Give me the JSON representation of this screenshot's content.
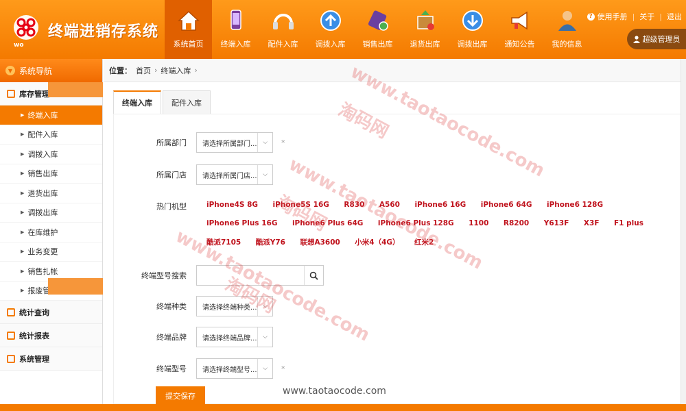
{
  "app": {
    "title": "终端进销存系统"
  },
  "nav": [
    {
      "label": "系统首页",
      "icon": "home-icon",
      "active": true
    },
    {
      "label": "终端入库",
      "icon": "phone-in-icon"
    },
    {
      "label": "配件入库",
      "icon": "headset-icon"
    },
    {
      "label": "调拨入库",
      "icon": "transfer-in-icon"
    },
    {
      "label": "销售出库",
      "icon": "sale-icon"
    },
    {
      "label": "退货出库",
      "icon": "return-icon"
    },
    {
      "label": "调拨出库",
      "icon": "transfer-out-icon"
    },
    {
      "label": "通知公告",
      "icon": "megaphone-icon"
    },
    {
      "label": "我的信息",
      "icon": "user-icon"
    }
  ],
  "top_links": {
    "help": "使用手册",
    "about": "关于",
    "logout": "退出"
  },
  "user": {
    "name": "超级管理员"
  },
  "sidebar": {
    "header": "系统导航",
    "groups": [
      {
        "label": "库存管理",
        "items": [
          "终端入库",
          "配件入库",
          "调拨入库",
          "销售出库",
          "退货出库",
          "调拨出库",
          "在库维护",
          "业务变更",
          "销售扎帐",
          "报废管"
        ]
      },
      {
        "label": "统计查询"
      },
      {
        "label": "统计报表"
      },
      {
        "label": "系统管理"
      }
    ]
  },
  "breadcrumb": {
    "prefix": "位置：",
    "home": "首页",
    "current": "终端入库"
  },
  "tabs": [
    "终端入库",
    "配件入库"
  ],
  "form": {
    "dept": {
      "label": "所属部门",
      "placeholder": "请选择所属部门..."
    },
    "store": {
      "label": "所属门店",
      "placeholder": "请选择所属门店..."
    },
    "hot_models": {
      "label": "热门机型",
      "items": [
        "iPhone4S 8G",
        "iPhone5S 16G",
        "R830",
        "A560",
        "iPhone6 16G",
        "iPhone6 64G",
        "iPhone6 128G",
        "iPhone6 Plus 16G",
        "iPhone6 Plus 64G",
        "iPhone6 Plus 128G",
        "1100",
        "R8200",
        "Y613F",
        "X3F",
        "F1 plus",
        "酷派7105",
        "酷派Y76",
        "联想A3600",
        "小米4（4G）",
        "红米2"
      ]
    },
    "search": {
      "label": "终端型号搜索",
      "placeholder": ""
    },
    "category": {
      "label": "终端种类",
      "placeholder": "请选择终端种类..."
    },
    "brand": {
      "label": "终端品牌",
      "placeholder": "请选择终端品牌..."
    },
    "model": {
      "label": "终端型号",
      "placeholder": "请选择终端型号..."
    },
    "required_mark": "*",
    "submit": "提交保存"
  },
  "watermarks": {
    "site": "www.taotaocode.com",
    "name": "淘码网"
  },
  "colors": {
    "accent": "#f47a00",
    "model_link": "#c0141e"
  }
}
